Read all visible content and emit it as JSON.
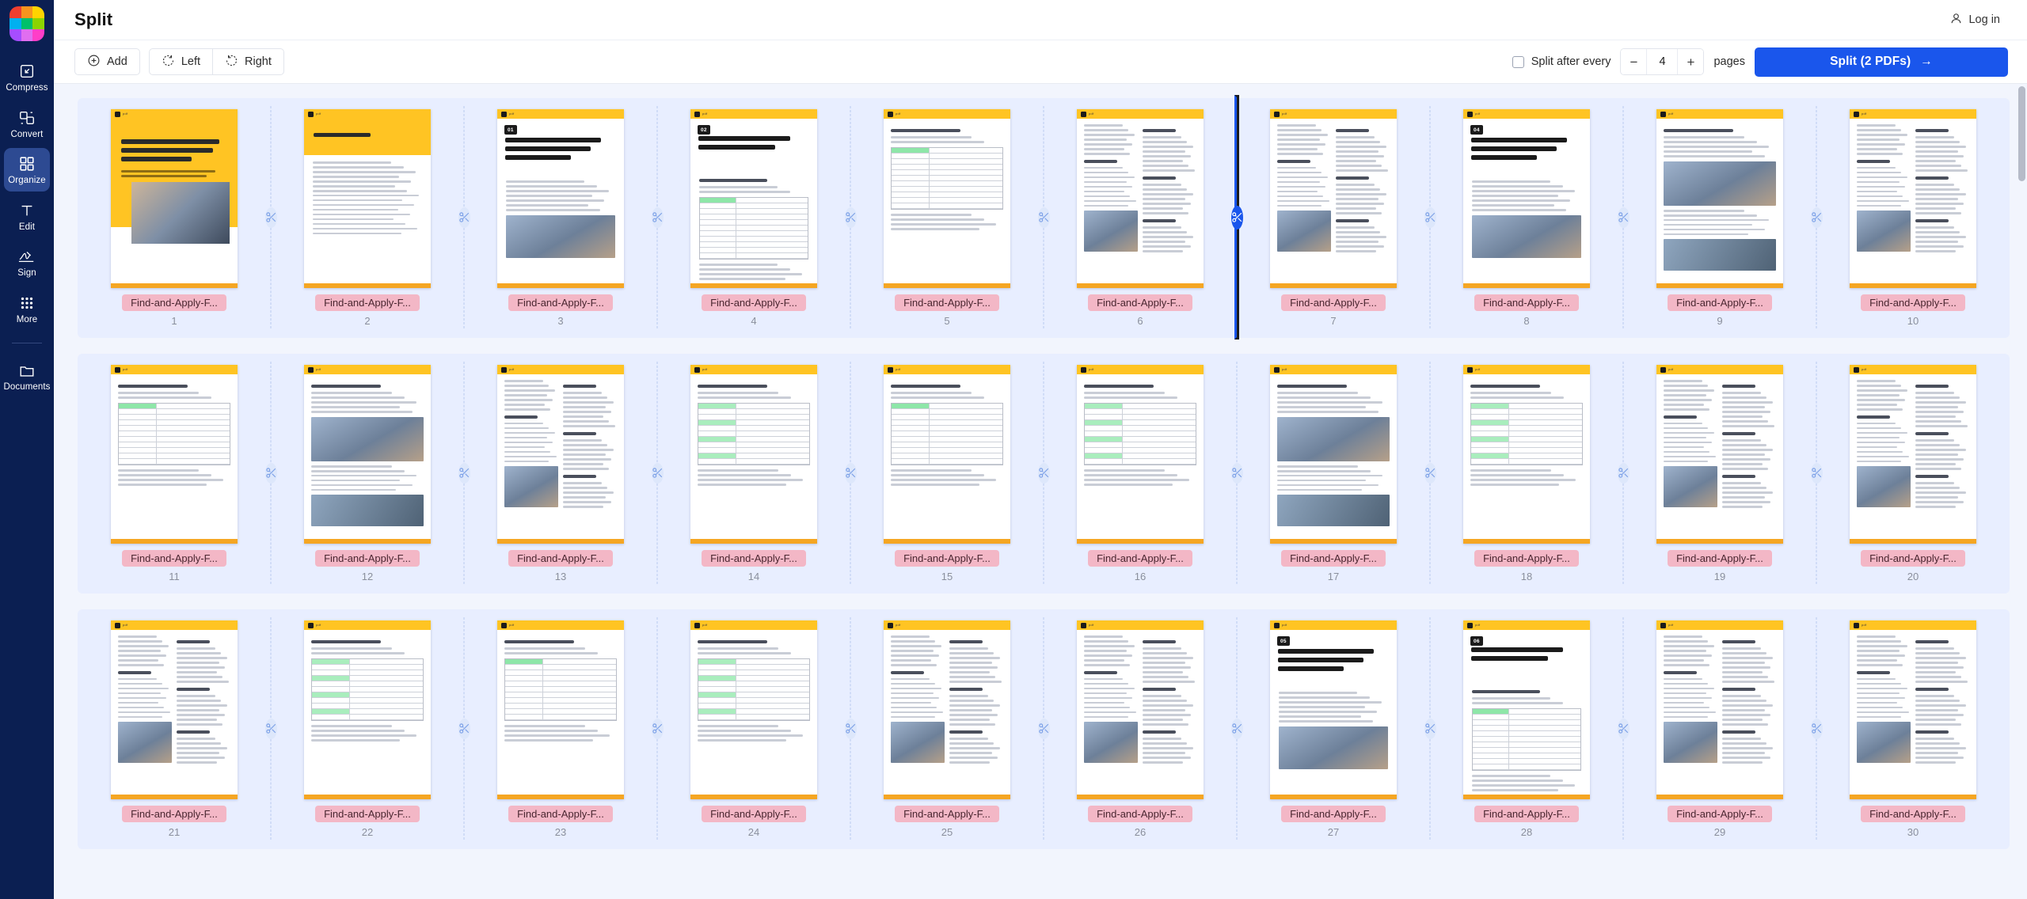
{
  "app": {
    "logo_name": "app-logo",
    "logo_colors": [
      "#f03e2f",
      "#f7941e",
      "#ffd400",
      "#00b0f0",
      "#00c06a",
      "#8cd400",
      "#a64dff",
      "#e06ef0",
      "#ff3ec8"
    ]
  },
  "sidebar": {
    "items": [
      {
        "id": "compress",
        "label": "Compress",
        "icon": "compress-icon",
        "active": false
      },
      {
        "id": "convert",
        "label": "Convert",
        "icon": "convert-icon",
        "active": false
      },
      {
        "id": "organize",
        "label": "Organize",
        "icon": "organize-icon",
        "active": true
      },
      {
        "id": "edit",
        "label": "Edit",
        "icon": "text-icon",
        "active": false
      },
      {
        "id": "sign",
        "label": "Sign",
        "icon": "signature-icon",
        "active": false
      },
      {
        "id": "more",
        "label": "More",
        "icon": "grid-dots-icon",
        "active": false
      }
    ],
    "footer_items": [
      {
        "id": "documents",
        "label": "Documents",
        "icon": "folder-icon",
        "active": false
      }
    ]
  },
  "header": {
    "title": "Split",
    "login_label": "Log in",
    "login_icon": "user-icon"
  },
  "toolbar": {
    "add_label": "Add",
    "add_icon": "plus-circle-icon",
    "rotate_left_label": "Left",
    "rotate_left_icon": "rotate-left-icon",
    "rotate_right_label": "Right",
    "rotate_right_icon": "rotate-right-icon",
    "split_every_label": "Split after every",
    "split_every_checked": false,
    "minus_label": "−",
    "plus_label": "+",
    "page_count_value": "4",
    "pages_label": "pages",
    "split_button_label": "Split (2 PDFs)",
    "split_button_arrow": "→",
    "accent_color": "#1a56ec"
  },
  "document": {
    "file_label": "Find-and-Apply-F...",
    "total_pages": 30,
    "active_split_after_page": 6,
    "pages": [
      {
        "n": "1",
        "label": "Find-and-Apply-F...",
        "layout": "cover"
      },
      {
        "n": "2",
        "label": "Find-and-Apply-F...",
        "layout": "toc"
      },
      {
        "n": "3",
        "label": "Find-and-Apply-F...",
        "layout": "chapter",
        "badge": "01"
      },
      {
        "n": "4",
        "label": "Find-and-Apply-F...",
        "layout": "chapter-table",
        "badge": "02"
      },
      {
        "n": "5",
        "label": "Find-and-Apply-F...",
        "layout": "table"
      },
      {
        "n": "6",
        "label": "Find-and-Apply-F...",
        "layout": "two-col-img"
      },
      {
        "n": "7",
        "label": "Find-and-Apply-F...",
        "layout": "two-col-img"
      },
      {
        "n": "8",
        "label": "Find-and-Apply-F...",
        "layout": "chapter",
        "badge": "04"
      },
      {
        "n": "9",
        "label": "Find-and-Apply-F...",
        "layout": "photo-top"
      },
      {
        "n": "10",
        "label": "Find-and-Apply-F...",
        "layout": "two-col-img"
      },
      {
        "n": "11",
        "label": "Find-and-Apply-F...",
        "layout": "table"
      },
      {
        "n": "12",
        "label": "Find-and-Apply-F...",
        "layout": "photo-top"
      },
      {
        "n": "13",
        "label": "Find-and-Apply-F...",
        "layout": "two-col-img"
      },
      {
        "n": "14",
        "label": "Find-and-Apply-F...",
        "layout": "table-green"
      },
      {
        "n": "15",
        "label": "Find-and-Apply-F...",
        "layout": "table"
      },
      {
        "n": "16",
        "label": "Find-and-Apply-F...",
        "layout": "table-green"
      },
      {
        "n": "17",
        "label": "Find-and-Apply-F...",
        "layout": "photo-top"
      },
      {
        "n": "18",
        "label": "Find-and-Apply-F...",
        "layout": "table-green"
      },
      {
        "n": "19",
        "label": "Find-and-Apply-F...",
        "layout": "two-col-img"
      },
      {
        "n": "20",
        "label": "Find-and-Apply-F...",
        "layout": "two-col-img"
      },
      {
        "n": "21",
        "label": "Find-and-Apply-F...",
        "layout": "two-col-img"
      },
      {
        "n": "22",
        "label": "Find-and-Apply-F...",
        "layout": "table-green"
      },
      {
        "n": "23",
        "label": "Find-and-Apply-F...",
        "layout": "table"
      },
      {
        "n": "24",
        "label": "Find-and-Apply-F...",
        "layout": "table-green"
      },
      {
        "n": "25",
        "label": "Find-and-Apply-F...",
        "layout": "two-col-img"
      },
      {
        "n": "26",
        "label": "Find-and-Apply-F...",
        "layout": "two-col-img"
      },
      {
        "n": "27",
        "label": "Find-and-Apply-F...",
        "layout": "chapter",
        "badge": "05"
      },
      {
        "n": "28",
        "label": "Find-and-Apply-F...",
        "layout": "chapter-table",
        "badge": "06"
      },
      {
        "n": "29",
        "label": "Find-and-Apply-F...",
        "layout": "two-col-img"
      },
      {
        "n": "30",
        "label": "Find-and-Apply-F...",
        "layout": "two-col-img"
      }
    ]
  },
  "colors": {
    "sidebar_bg": "#0b1f52",
    "sidebar_active": "#2d4a92",
    "canvas_bg": "#f2f5fd",
    "row_bg": "#e8eeff",
    "label_badge": "#f3b7c6",
    "page_accent": "#ffc423"
  }
}
